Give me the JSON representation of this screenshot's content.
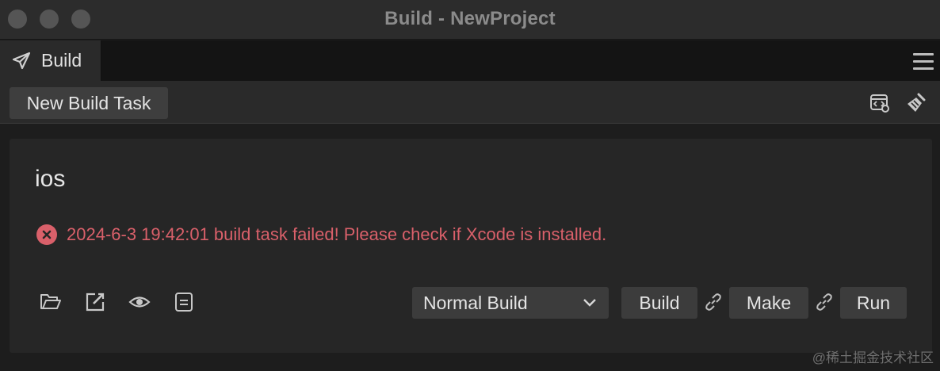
{
  "window": {
    "title": "Build - NewProject"
  },
  "tabs": [
    {
      "label": "Build",
      "icon": "paper-plane-icon"
    }
  ],
  "toolbar": {
    "new_task_label": "New Build Task",
    "icons": [
      "code-settings-icon",
      "clean-brush-icon"
    ]
  },
  "task": {
    "platform": "ios",
    "status": "error",
    "message": "2024-6-3 19:42:01 build task failed! Please check if Xcode is installed.",
    "footer_icons": [
      "folder-icon",
      "edit-icon",
      "eye-icon",
      "log-icon"
    ],
    "build_mode": "Normal Build",
    "actions": {
      "build": "Build",
      "make": "Make",
      "run": "Run"
    }
  },
  "watermark": "@稀土掘金技术社区",
  "colors": {
    "error": "#d9606a",
    "background": "#1c1c1c",
    "panel": "#262626",
    "button": "#3c3c3c"
  }
}
